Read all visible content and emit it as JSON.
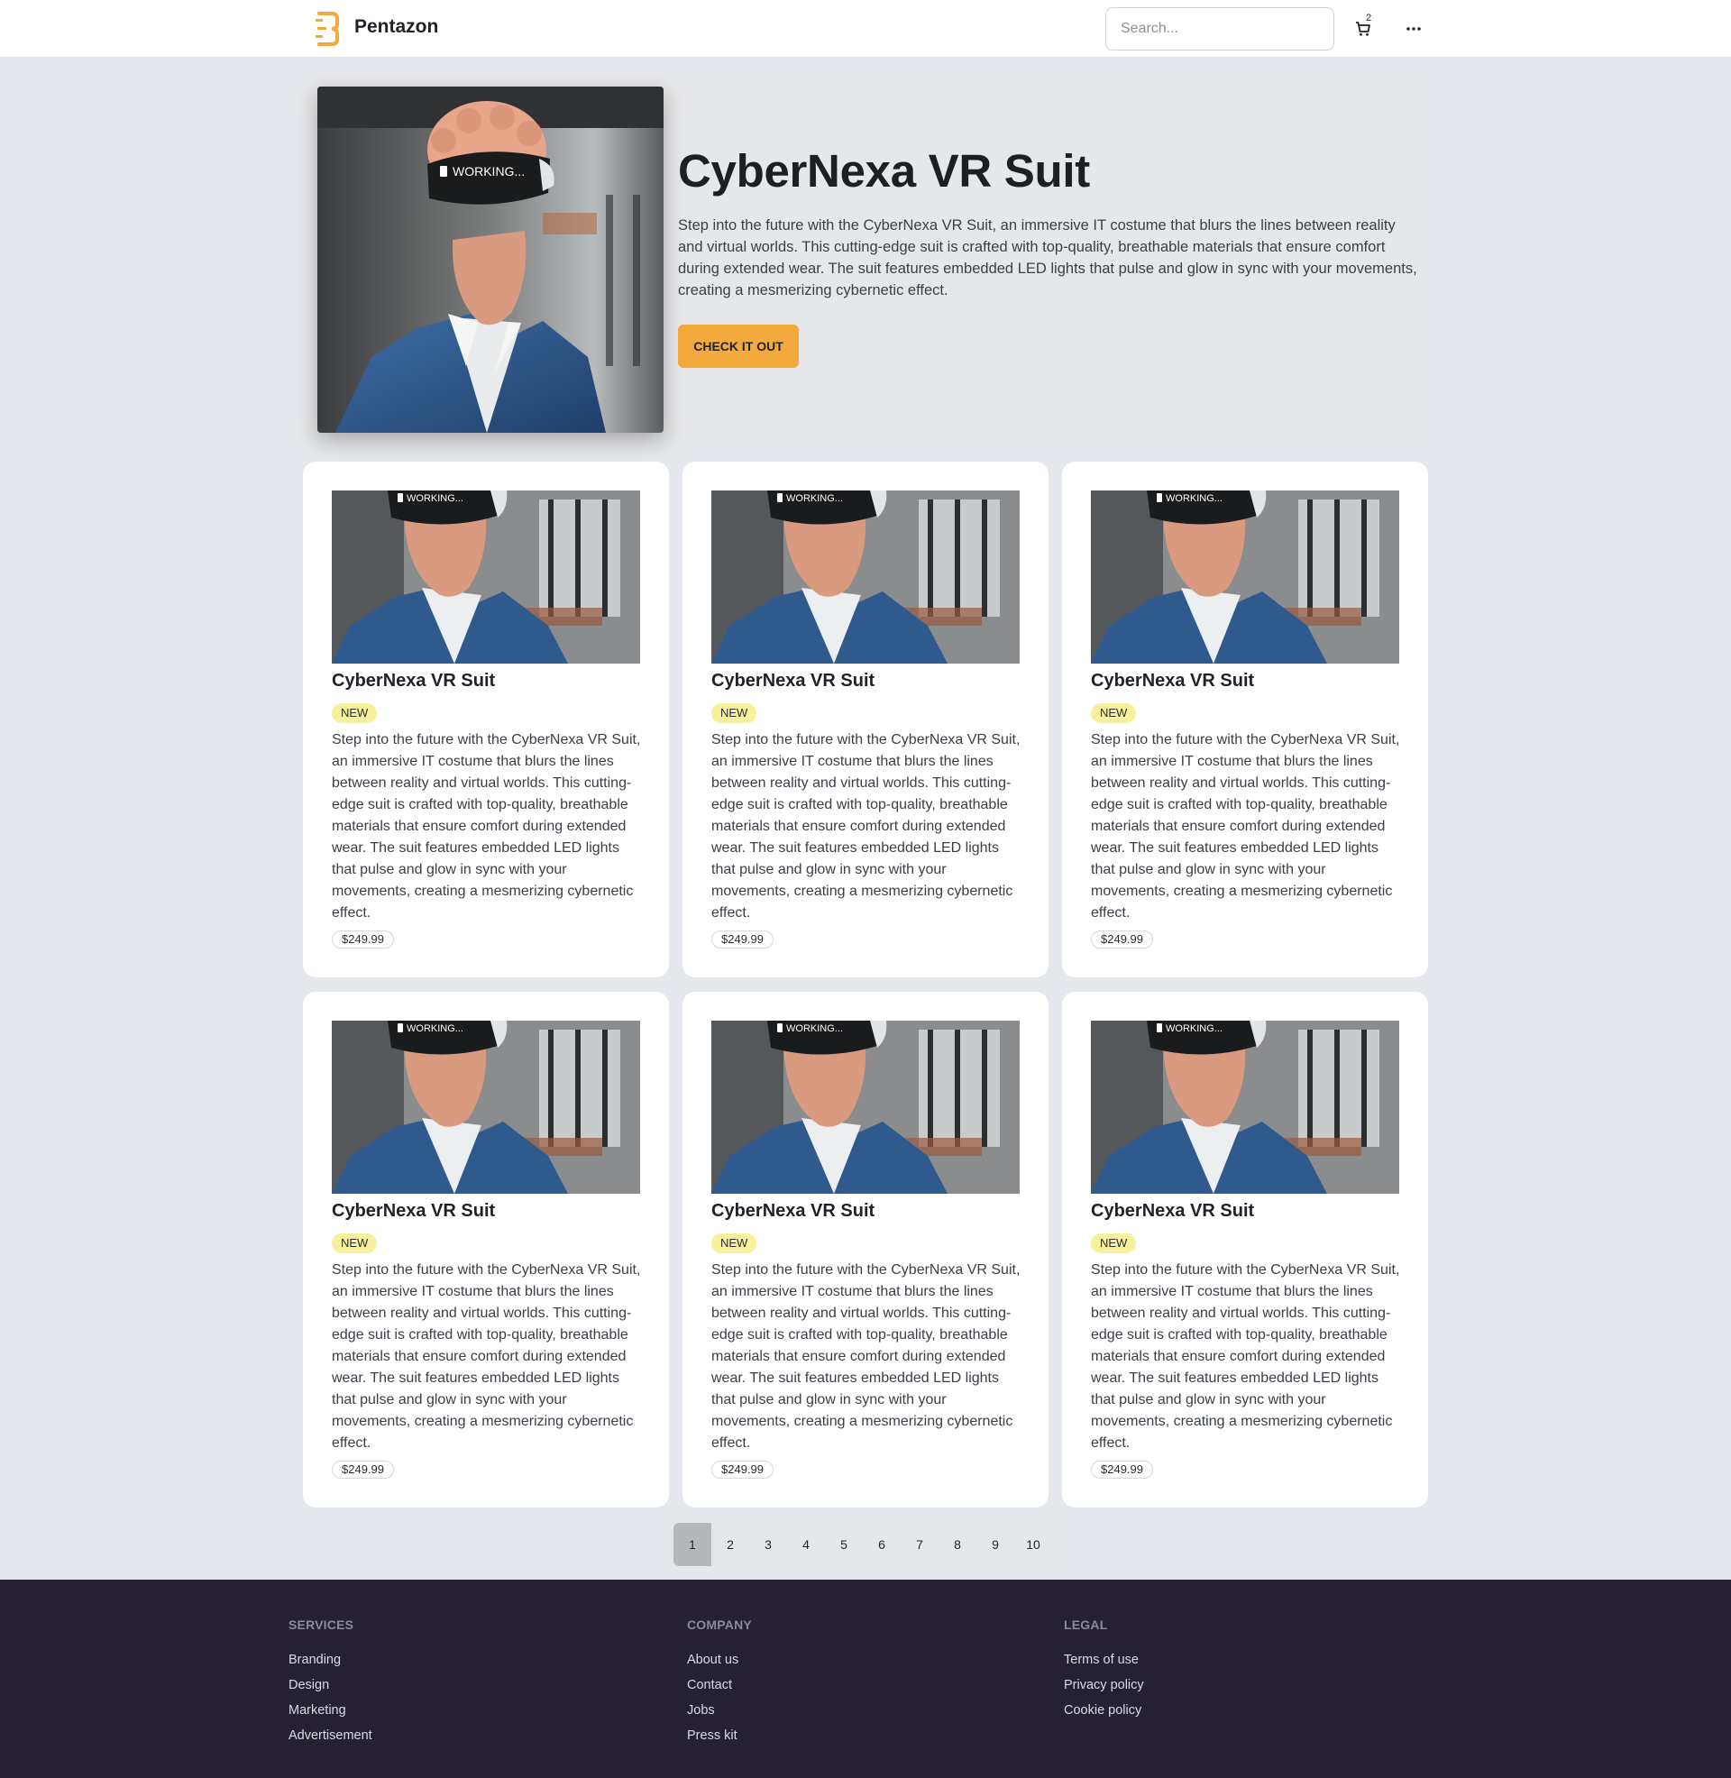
{
  "header": {
    "brand": "Pentazon",
    "search_placeholder": "Search...",
    "cart_count": "2"
  },
  "hero": {
    "title": "CyberNexa VR Suit",
    "description": "Step into the future with the CyberNexa VR Suit, an immersive IT costume that blurs the lines between reality and virtual worlds. This cutting-edge suit is crafted with top-quality, breathable materials that ensure comfort during extended wear. The suit features embedded LED lights that pulse and glow in sync with your movements, creating a mesmerizing cybernetic effect.",
    "cta_label": "CHECK IT OUT",
    "image_text": "WORKING..."
  },
  "products": [
    {
      "title": "CyberNexa VR Suit",
      "badge": "NEW",
      "description": "Step into the future with the CyberNexa VR Suit, an immersive IT costume that blurs the lines between reality and virtual worlds. This cutting-edge suit is crafted with top-quality, breathable materials that ensure comfort during extended wear. The suit features embedded LED lights that pulse and glow in sync with your movements, creating a mesmerizing cybernetic effect.",
      "price": "$249.99",
      "image_text": "WORKING..."
    },
    {
      "title": "CyberNexa VR Suit",
      "badge": "NEW",
      "description": "Step into the future with the CyberNexa VR Suit, an immersive IT costume that blurs the lines between reality and virtual worlds. This cutting-edge suit is crafted with top-quality, breathable materials that ensure comfort during extended wear. The suit features embedded LED lights that pulse and glow in sync with your movements, creating a mesmerizing cybernetic effect.",
      "price": "$249.99",
      "image_text": "WORKING..."
    },
    {
      "title": "CyberNexa VR Suit",
      "badge": "NEW",
      "description": "Step into the future with the CyberNexa VR Suit, an immersive IT costume that blurs the lines between reality and virtual worlds. This cutting-edge suit is crafted with top-quality, breathable materials that ensure comfort during extended wear. The suit features embedded LED lights that pulse and glow in sync with your movements, creating a mesmerizing cybernetic effect.",
      "price": "$249.99",
      "image_text": "WORKING..."
    },
    {
      "title": "CyberNexa VR Suit",
      "badge": "NEW",
      "description": "Step into the future with the CyberNexa VR Suit, an immersive IT costume that blurs the lines between reality and virtual worlds. This cutting-edge suit is crafted with top-quality, breathable materials that ensure comfort during extended wear. The suit features embedded LED lights that pulse and glow in sync with your movements, creating a mesmerizing cybernetic effect.",
      "price": "$249.99",
      "image_text": "WORKING..."
    },
    {
      "title": "CyberNexa VR Suit",
      "badge": "NEW",
      "description": "Step into the future with the CyberNexa VR Suit, an immersive IT costume that blurs the lines between reality and virtual worlds. This cutting-edge suit is crafted with top-quality, breathable materials that ensure comfort during extended wear. The suit features embedded LED lights that pulse and glow in sync with your movements, creating a mesmerizing cybernetic effect.",
      "price": "$249.99",
      "image_text": "WORKING..."
    },
    {
      "title": "CyberNexa VR Suit",
      "badge": "NEW",
      "description": "Step into the future with the CyberNexa VR Suit, an immersive IT costume that blurs the lines between reality and virtual worlds. This cutting-edge suit is crafted with top-quality, breathable materials that ensure comfort during extended wear. The suit features embedded LED lights that pulse and glow in sync with your movements, creating a mesmerizing cybernetic effect.",
      "price": "$249.99",
      "image_text": "WORKING..."
    }
  ],
  "pagination": {
    "pages": [
      "1",
      "2",
      "3",
      "4",
      "5",
      "6",
      "7",
      "8",
      "9",
      "10"
    ],
    "current": "1"
  },
  "footer": {
    "columns": [
      {
        "heading": "Services",
        "links": [
          "Branding",
          "Design",
          "Marketing",
          "Advertisement"
        ]
      },
      {
        "heading": "Company",
        "links": [
          "About us",
          "Contact",
          "Jobs",
          "Press kit"
        ]
      },
      {
        "heading": "Legal",
        "links": [
          "Terms of use",
          "Privacy policy",
          "Cookie policy"
        ]
      }
    ]
  },
  "icons": {
    "logo": "pentazon-logo-icon",
    "cart": "cart-icon",
    "more": "more-horizontal-icon"
  },
  "colors": {
    "accent": "#f3a93b",
    "badge": "#f6f19a",
    "footer_bg": "#252133",
    "page_bg": "#e4e7eb"
  }
}
